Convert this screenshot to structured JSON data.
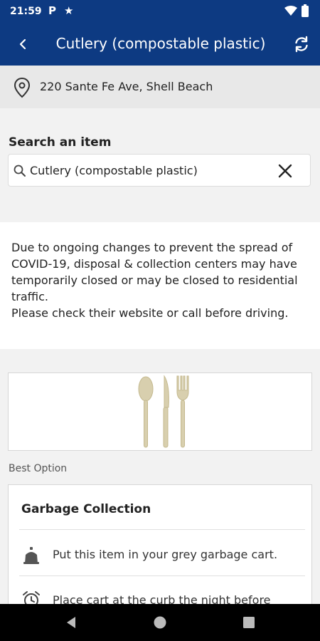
{
  "status_bar": {
    "time": "21:59",
    "left_icons": [
      "parking-icon",
      "star-icon"
    ],
    "right_icons": [
      "wifi-icon",
      "battery-icon"
    ]
  },
  "app_bar": {
    "title": "Cutlery (compostable plastic)",
    "background": "#0d3a82"
  },
  "address": {
    "text": "220 Sante Fe Ave, Shell Beach"
  },
  "search": {
    "label": "Search an item",
    "value": "Cutlery (compostable plastic)"
  },
  "notice": {
    "text": "Due to ongoing changes to prevent the spread of COVID-19, disposal & collection centers may have temporarily closed or may be closed to residential traffic.\nPlease check their website or call before driving."
  },
  "best_option": {
    "label": "Best Option"
  },
  "garbage_card": {
    "title": "Garbage Collection",
    "steps": [
      {
        "icon": "garbage-cart-icon",
        "text": "Put this item in your grey garbage cart."
      },
      {
        "icon": "alarm-clock-icon",
        "text": "Place cart at the curb the night before"
      }
    ]
  }
}
